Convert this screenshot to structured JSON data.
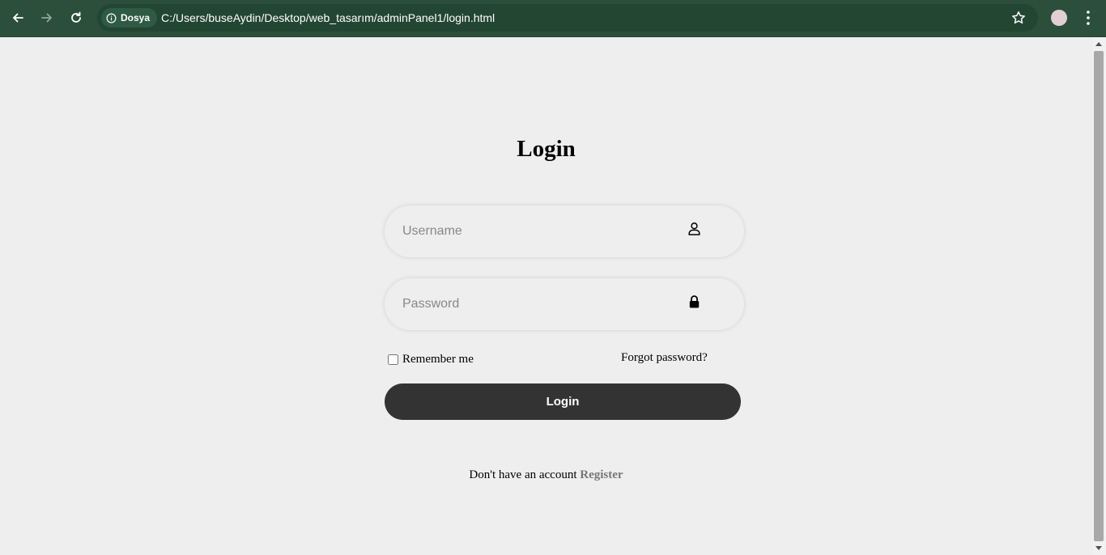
{
  "browser": {
    "site_chip": "Dosya",
    "url": "C:/Users/buseAydin/Desktop/web_tasarım/adminPanel1/login.html",
    "icons": [
      "back-arrow-icon",
      "forward-arrow-icon",
      "reload-icon",
      "info-icon",
      "star-icon",
      "profile-avatar",
      "kebab-menu-icon"
    ]
  },
  "login": {
    "title": "Login",
    "username_placeholder": "Username",
    "username_icon": "user-icon",
    "password_placeholder": "Password",
    "password_icon": "lock-icon",
    "remember_label": "Remember me",
    "remember_checked": false,
    "forgot_link": "Forgot password?",
    "submit_label": "Login",
    "register_text": "Don't have an account",
    "register_link": "Register"
  },
  "colors": {
    "chrome_bar": "#2c4f3b",
    "page_background": "#eeeeee",
    "button": "#333333",
    "register_link": "#777777"
  }
}
